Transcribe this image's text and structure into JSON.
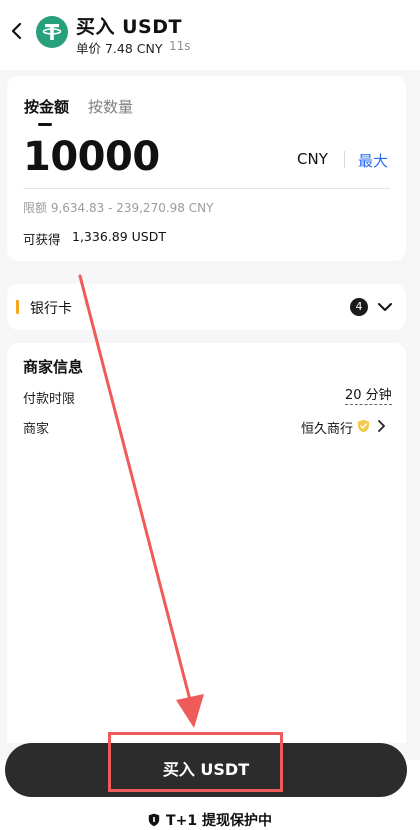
{
  "header": {
    "title": "买入 USDT",
    "unit_price": "单价 7.48 CNY",
    "timer": "11s",
    "icons": [
      "chevron-left-icon",
      "tether-icon"
    ]
  },
  "amount_card": {
    "tab_amount": "按金额",
    "tab_quantity": "按数量",
    "amount_value": "10000",
    "currency": "CNY",
    "max_label": "最大",
    "limit_text": "限额 9,634.83 - 239,270.98 CNY",
    "obtain_label": "可获得",
    "obtain_value": "1,336.89 USDT"
  },
  "payment": {
    "method_label": "银行卡",
    "count": "4"
  },
  "merchant": {
    "title": "商家信息",
    "pay_time_label": "付款时限",
    "pay_time_value": "20 分钟",
    "merchant_label": "商家",
    "merchant_value": "恒久商行"
  },
  "footer": {
    "buy_button": "买入 USDT",
    "protection": "T+1 提现保护中"
  },
  "colors": {
    "accent_blue": "#2a6df5",
    "tether_green": "#26a17b",
    "button_dark": "#2c2c2c",
    "annotation_red": "#ef5b5b",
    "orange_marker": "#f5a623"
  }
}
